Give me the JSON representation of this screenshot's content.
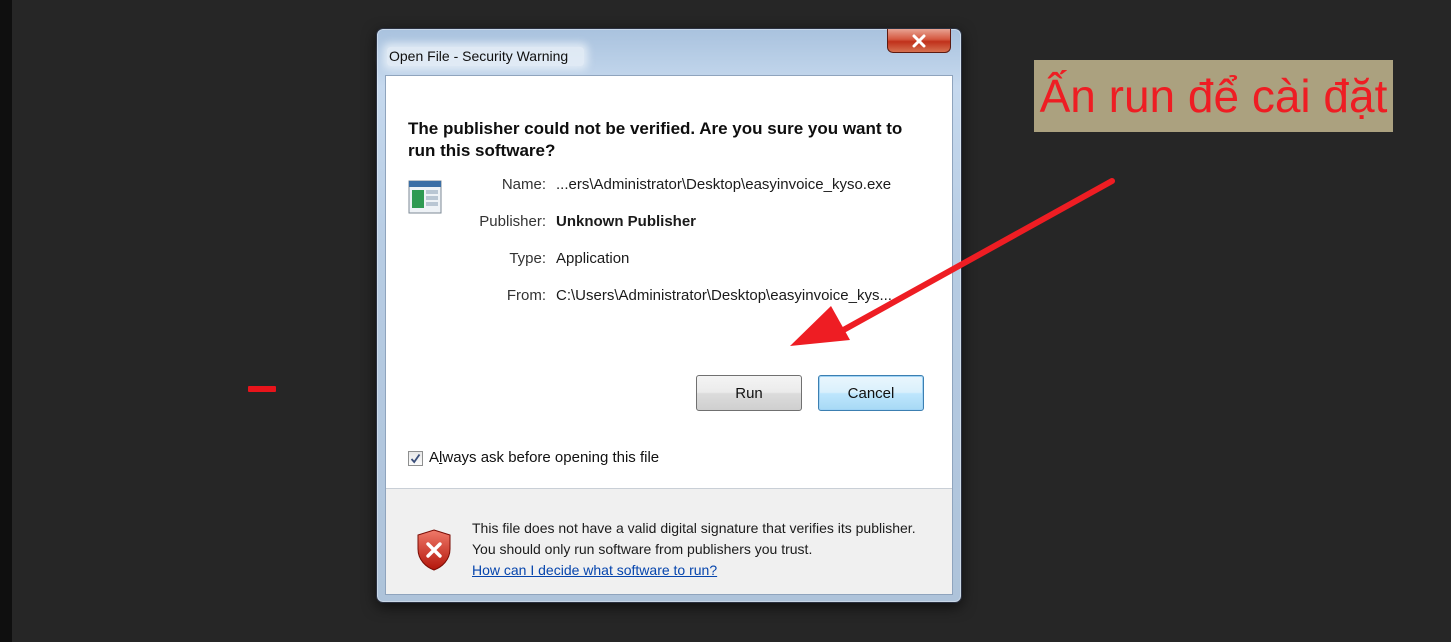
{
  "dialog": {
    "title": "Open File - Security Warning",
    "close_glyph": "x",
    "question": "The publisher could not be verified.  Are you sure you want to run this software?",
    "details": [
      {
        "label": "Name:",
        "value": "...ers\\Administrator\\Desktop\\easyinvoice_kyso.exe",
        "bold": false
      },
      {
        "label": "Publisher:",
        "value": "Unknown Publisher",
        "bold": true
      },
      {
        "label": "Type:",
        "value": "Application",
        "bold": false
      },
      {
        "label": "From:",
        "value": "C:\\Users\\Administrator\\Desktop\\easyinvoice_kys...",
        "bold": false
      }
    ],
    "buttons": {
      "run": "Run",
      "cancel": "Cancel"
    },
    "checkbox": {
      "checked": true,
      "label_prefix": "A",
      "label_underlined": "l",
      "label_suffix": "ways ask before opening this file"
    },
    "warning": {
      "text": "This file does not have a valid digital signature that verifies its publisher.  You should only run software from publishers you trust.",
      "link": "How can I decide what software to run?"
    }
  },
  "annotation": {
    "label": "Ấn run để cài đặt",
    "color": "#ee1d23",
    "background": "#aba17f"
  },
  "icons": {
    "close": "close-icon",
    "app": "application-icon",
    "shield": "security-shield-icon",
    "check": "checkmark-icon"
  }
}
